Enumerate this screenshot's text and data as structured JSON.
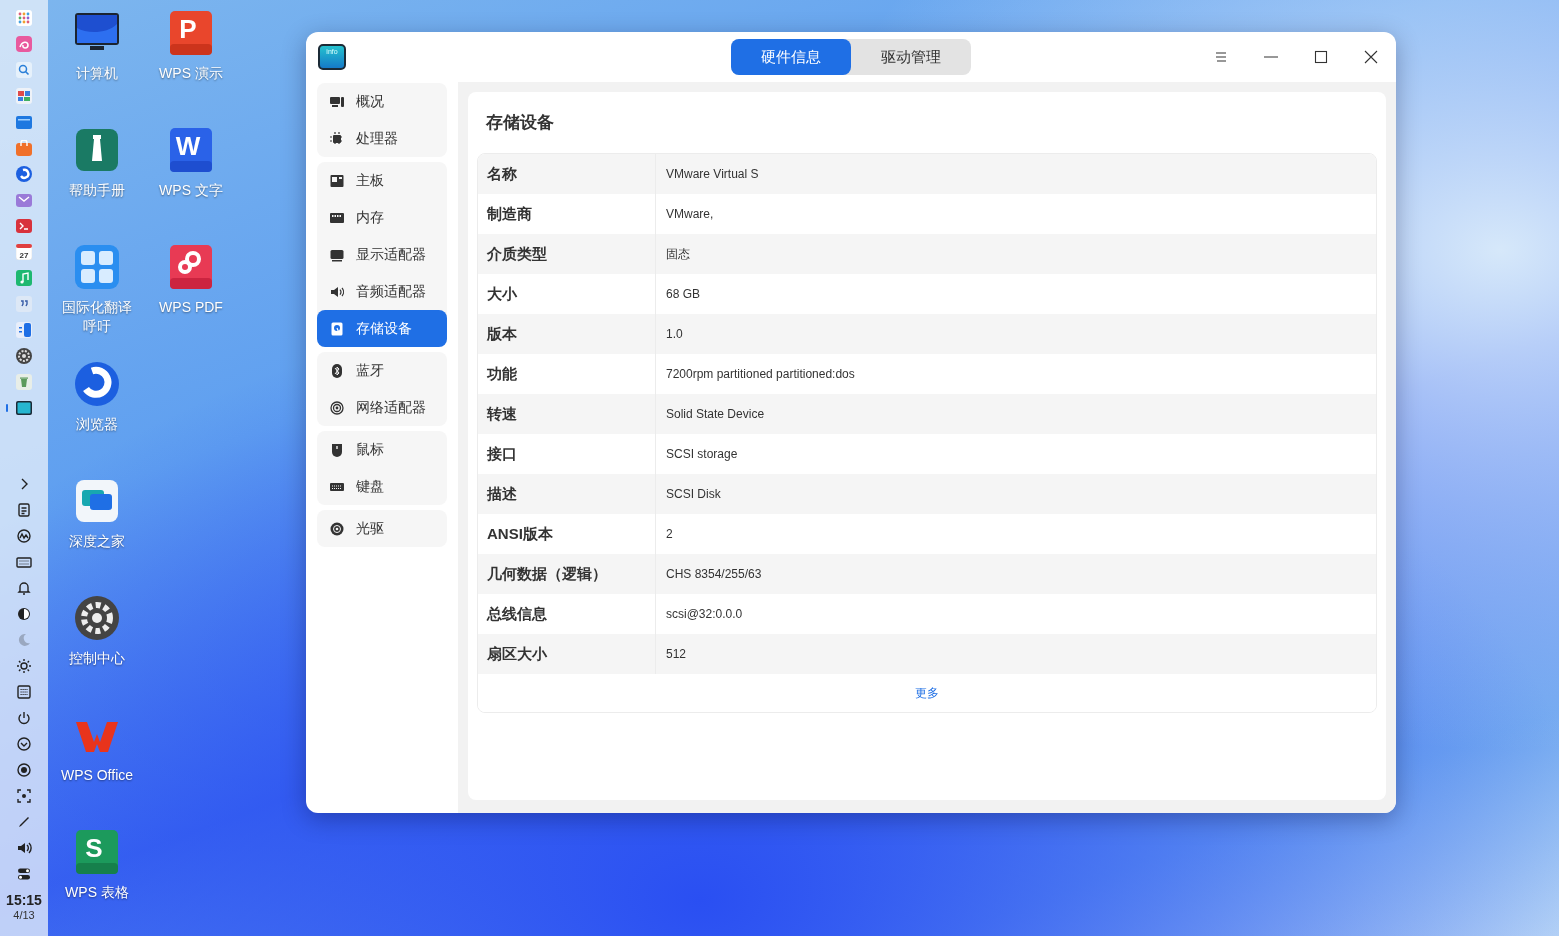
{
  "dock": {
    "apps": [
      {
        "active": false
      },
      {
        "active": false
      },
      {
        "active": false
      },
      {
        "active": false
      },
      {
        "active": false
      },
      {
        "active": false
      },
      {
        "active": false
      },
      {
        "active": false
      },
      {
        "active": false
      },
      {
        "active": false,
        "glyph": "27"
      },
      {
        "active": false
      },
      {
        "active": false
      },
      {
        "active": false
      },
      {
        "active": false
      },
      {
        "active": false
      },
      {
        "active": true
      }
    ],
    "time": "15:15",
    "date": "4/13"
  },
  "desktop": {
    "icons": [
      {
        "label": "计算机"
      },
      {
        "label": "帮助手册"
      },
      {
        "label": "国际化翻译呼吁"
      },
      {
        "label": "浏览器"
      },
      {
        "label": "深度之家"
      },
      {
        "label": "控制中心"
      },
      {
        "label": "WPS Office"
      },
      {
        "label": "WPS 表格",
        "glyph": "S"
      },
      {
        "label": "WPS 演示",
        "glyph": "P"
      },
      {
        "label": "WPS 文字",
        "glyph": "W"
      },
      {
        "label": "WPS PDF"
      }
    ]
  },
  "window": {
    "app_icon_text": "info",
    "tabs": [
      {
        "label": "硬件信息",
        "selected": true
      },
      {
        "label": "驱动管理",
        "selected": false
      }
    ],
    "sidebar": {
      "groups": [
        {
          "items": [
            {
              "label": "概况",
              "selected": false
            },
            {
              "label": "处理器",
              "selected": false
            }
          ]
        },
        {
          "items": [
            {
              "label": "主板",
              "selected": false
            },
            {
              "label": "内存",
              "selected": false
            },
            {
              "label": "显示适配器",
              "selected": false
            },
            {
              "label": "音频适配器",
              "selected": false
            },
            {
              "label": "存储设备",
              "selected": true
            }
          ]
        },
        {
          "items": [
            {
              "label": "蓝牙",
              "selected": false
            },
            {
              "label": "网络适配器",
              "selected": false
            }
          ]
        },
        {
          "items": [
            {
              "label": "鼠标",
              "selected": false
            },
            {
              "label": "键盘",
              "selected": false
            }
          ]
        },
        {
          "items": [
            {
              "label": "光驱",
              "selected": false
            }
          ]
        }
      ]
    },
    "content": {
      "title": "存储设备",
      "rows": [
        {
          "key": "名称",
          "value": "VMware Virtual S"
        },
        {
          "key": "制造商",
          "value": "VMware,"
        },
        {
          "key": "介质类型",
          "value": "固态"
        },
        {
          "key": "大小",
          "value": "68 GB"
        },
        {
          "key": "版本",
          "value": "1.0"
        },
        {
          "key": "功能",
          "value": "7200rpm partitioned partitioned:dos"
        },
        {
          "key": "转速",
          "value": "Solid State Device"
        },
        {
          "key": "接口",
          "value": "SCSI storage"
        },
        {
          "key": "描述",
          "value": "SCSI Disk"
        },
        {
          "key": "ANSI版本",
          "value": "2"
        },
        {
          "key": "几何数据（逻辑）",
          "value": "CHS 8354/255/63"
        },
        {
          "key": "总线信息",
          "value": "scsi@32:0.0.0"
        },
        {
          "key": "扇区大小",
          "value": "512"
        }
      ],
      "more_link": "更多"
    }
  }
}
